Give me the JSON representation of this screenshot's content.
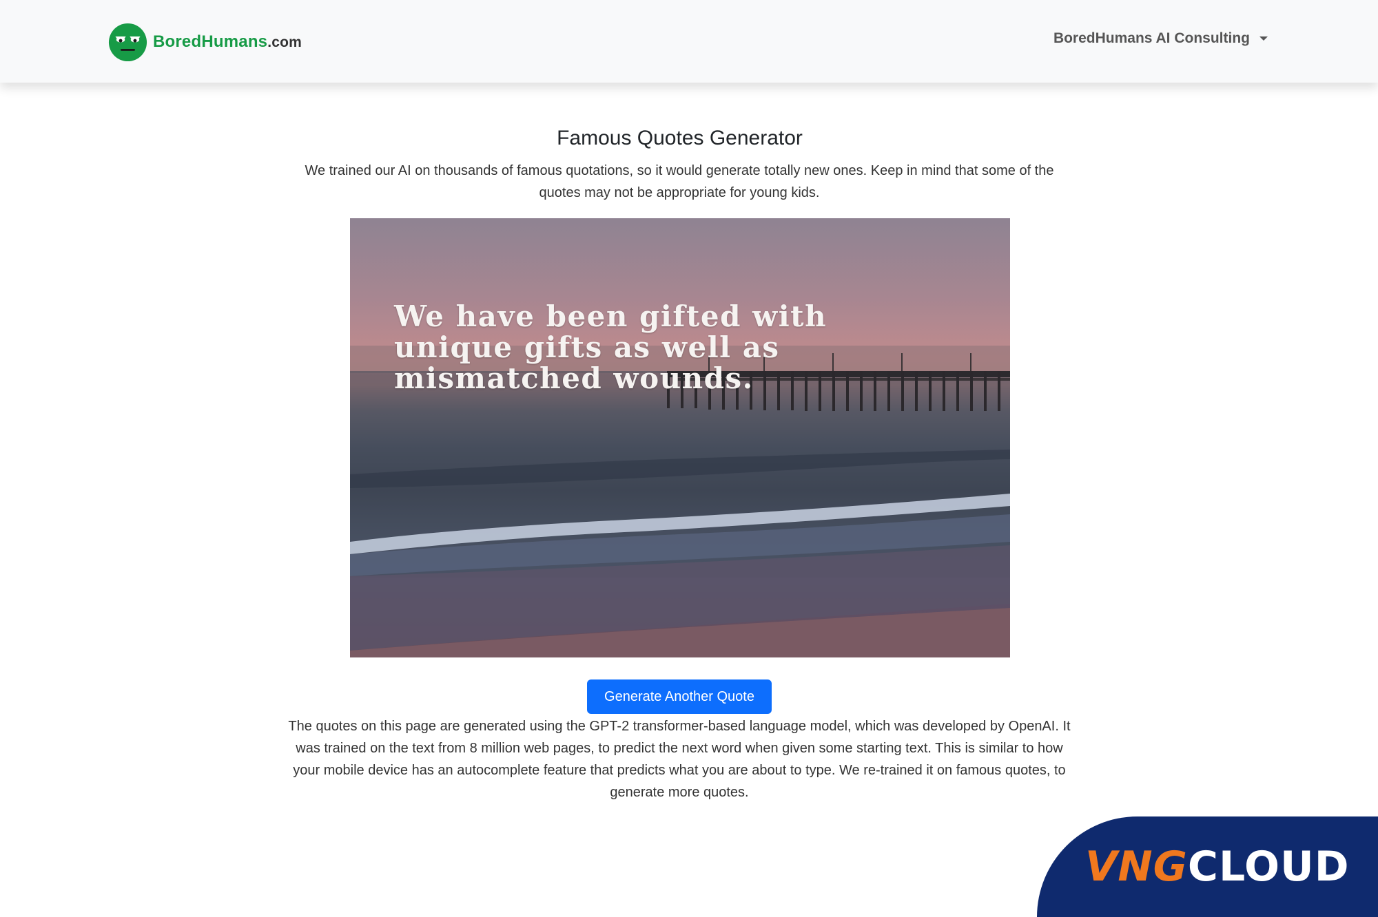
{
  "header": {
    "brand": {
      "logo_icon": "bored-face-logo-icon",
      "name_part1": "BoredHumans",
      "name_part2": ".com"
    },
    "menu": {
      "label": "BoredHumans AI Consulting",
      "icon": "caret-down-icon"
    }
  },
  "main": {
    "title": "Famous Quotes Generator",
    "intro": "We trained our AI on thousands of famous quotations, so it would generate totally new ones. Keep in mind that some of the quotes may not be appropriate for young kids.",
    "quote_image": {
      "scene": "beach-pier-sunset-image",
      "quote_lines": [
        "We have been gifted with",
        "unique gifts as well as",
        "mismatched wounds."
      ]
    },
    "generate_button": "Generate Another Quote",
    "about": "The quotes on this page are generated using the GPT-2 transformer-based language model, which was developed by OpenAI. It was trained on the text from 8 million web pages, to predict the next word when given some starting text. This is similar to how your mobile device has an autocomplete feature that predicts what you are about to type. We re-trained it on famous quotes, to generate more quotes."
  },
  "watermark": {
    "part1": "VNG",
    "part2": "CLOUD"
  },
  "colors": {
    "brand_green": "#179b46",
    "button_blue": "#0d6efd",
    "watermark_navy": "#0f2a6e",
    "watermark_orange": "#f0781e"
  }
}
